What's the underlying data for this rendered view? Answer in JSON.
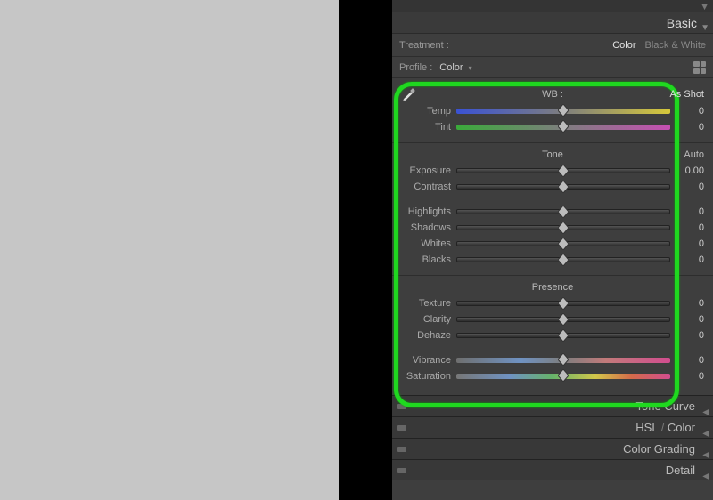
{
  "panels": {
    "basic": {
      "title": "Basic",
      "treatment": {
        "label": "Treatment :",
        "options": {
          "color": "Color",
          "bw": "Black & White"
        },
        "active": "color"
      },
      "profile": {
        "label": "Profile :",
        "value": "Color"
      },
      "wb": {
        "title": "WB :",
        "preset": "As Shot",
        "sliders": {
          "temp": {
            "label": "Temp",
            "value": "0"
          },
          "tint": {
            "label": "Tint",
            "value": "0"
          }
        }
      },
      "tone": {
        "title": "Tone",
        "auto": "Auto",
        "sliders": {
          "exposure": {
            "label": "Exposure",
            "value": "0.00"
          },
          "contrast": {
            "label": "Contrast",
            "value": "0"
          },
          "highlights": {
            "label": "Highlights",
            "value": "0"
          },
          "shadows": {
            "label": "Shadows",
            "value": "0"
          },
          "whites": {
            "label": "Whites",
            "value": "0"
          },
          "blacks": {
            "label": "Blacks",
            "value": "0"
          }
        }
      },
      "presence": {
        "title": "Presence",
        "sliders": {
          "texture": {
            "label": "Texture",
            "value": "0"
          },
          "clarity": {
            "label": "Clarity",
            "value": "0"
          },
          "dehaze": {
            "label": "Dehaze",
            "value": "0"
          },
          "vibrance": {
            "label": "Vibrance",
            "value": "0"
          },
          "saturation": {
            "label": "Saturation",
            "value": "0"
          }
        }
      }
    },
    "closed": {
      "tone_curve": "Tone Curve",
      "hsl": {
        "a": "HSL",
        "b": "Color"
      },
      "color_grading": "Color Grading",
      "detail": "Detail"
    }
  }
}
